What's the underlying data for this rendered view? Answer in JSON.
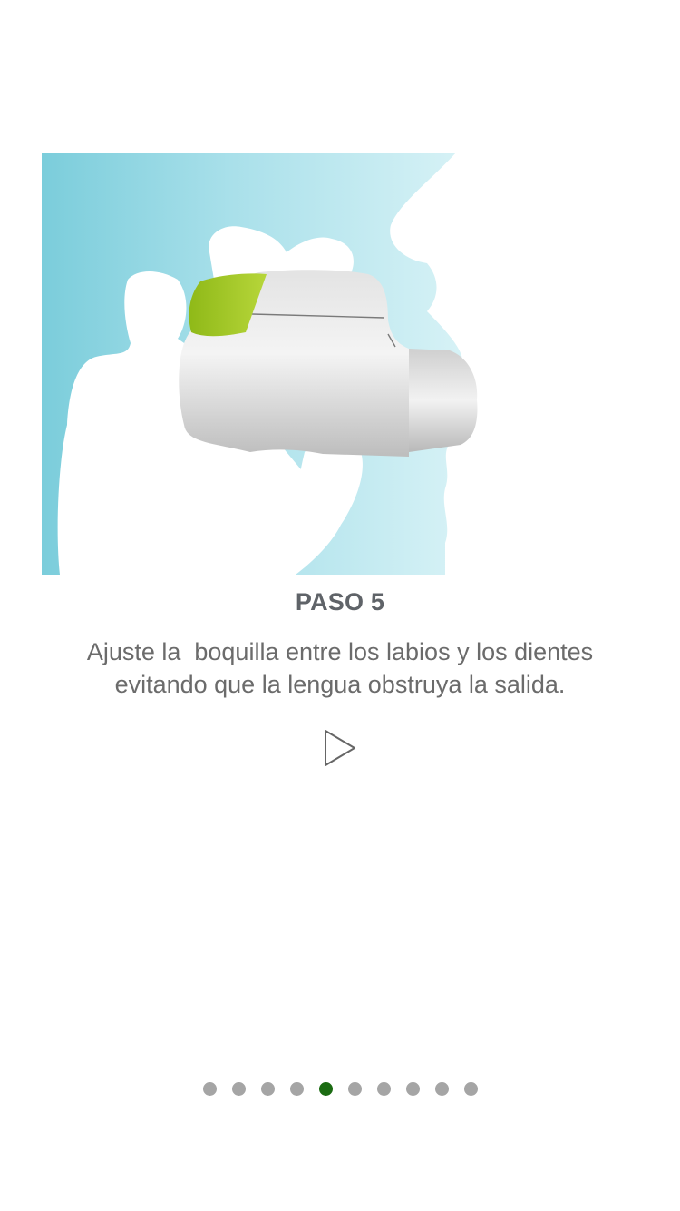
{
  "step": {
    "title": "PASO 5",
    "description": "Ajuste la  boquilla entre los labios y los dientes\nevitando que la lengua obstruya la salida."
  },
  "illustration": {
    "subject": "inhaler-in-mouth",
    "colors": {
      "background_blue": "#7fcfdc",
      "light_blue": "#c6ecf2",
      "device_gray": "#d9d9d9",
      "cap_green": "#9cc41c"
    }
  },
  "controls": {
    "play_icon": "play-triangle-icon"
  },
  "pager": {
    "total": 10,
    "active_index": 4,
    "active_color": "#1b6b12",
    "inactive_color": "#a5a5a5"
  }
}
